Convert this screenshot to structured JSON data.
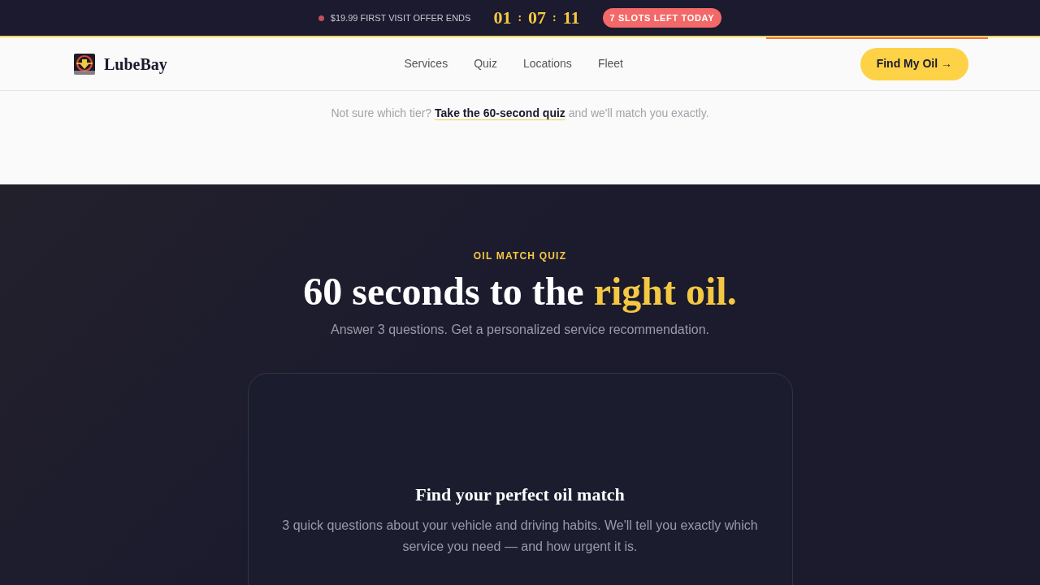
{
  "promo_bar": {
    "offer": "$19.99 FIRST VISIT OFFER ENDS",
    "countdown": {
      "units": [
        "01",
        "07",
        "11"
      ],
      "separators": [
        ":",
        ":"
      ]
    },
    "badge": "7 SLOTS LEFT TODAY"
  },
  "nav": {
    "logo": "LubeBay",
    "links": [
      {
        "label": "Services"
      },
      {
        "label": "Quiz"
      },
      {
        "label": "Locations"
      },
      {
        "label": "Fleet"
      }
    ],
    "cta": "Find My Oil →"
  },
  "quiz_prompt": {
    "before": "Not sure which tier?",
    "link": "Take the 60-second quiz",
    "after": "and we'll match you exactly."
  },
  "quiz_section": {
    "eyebrow": "OIL MATCH QUIZ",
    "heading": "60 seconds to the",
    "heading_highlight": "right oil.",
    "subheading": "Answer 3 questions. Get a personalized service recommendation.",
    "card": {
      "title": "Find your perfect oil match",
      "description": "3 quick questions about your vehicle and driving habits. We'll tell you exactly which service you need — and how urgent it is."
    }
  }
}
